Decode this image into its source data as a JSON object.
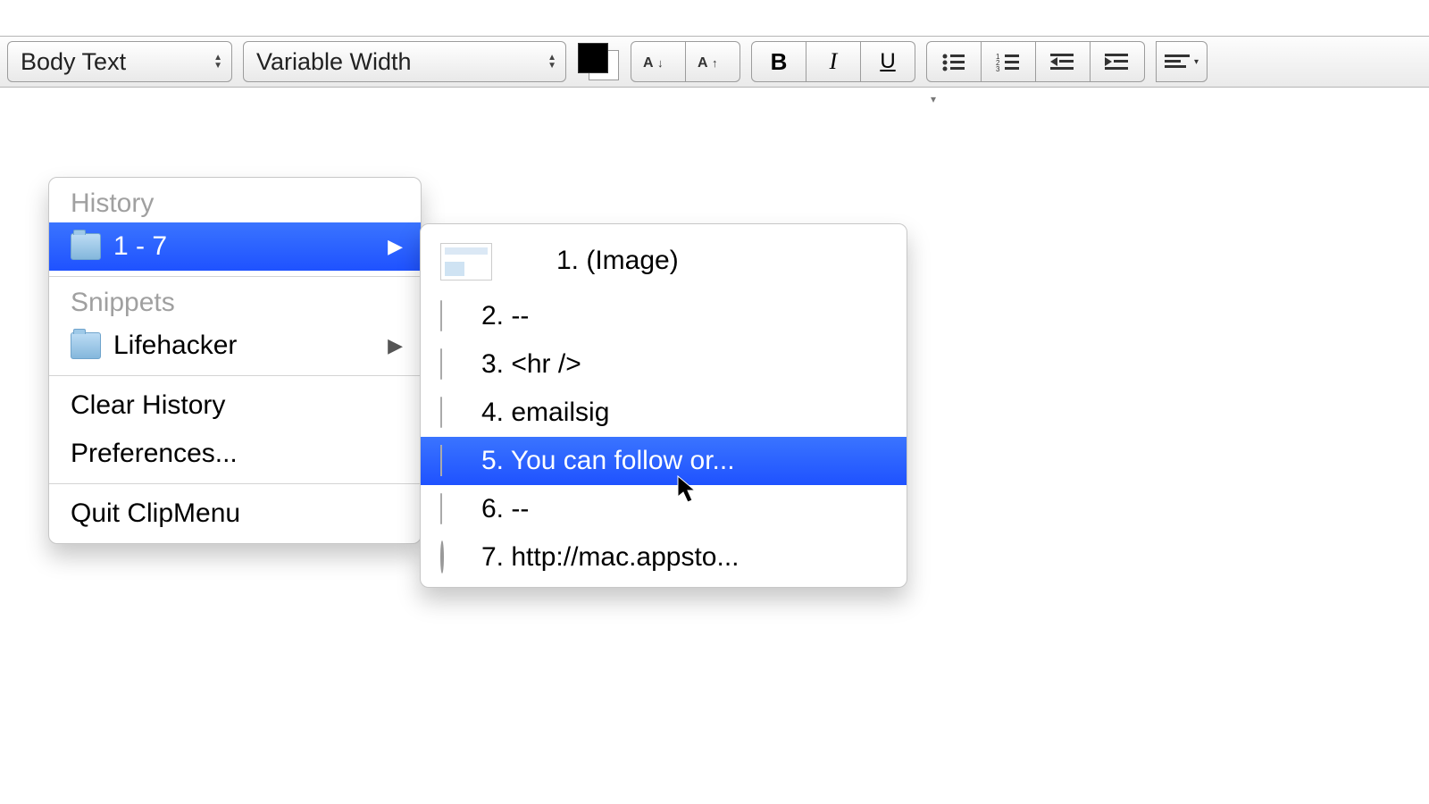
{
  "toolbar": {
    "style_label": "Body Text",
    "font_label": "Variable Width"
  },
  "menu": {
    "history_label": "History",
    "history_range": "1 - 7",
    "snippets_label": "Snippets",
    "snippets_folder": "Lifehacker",
    "clear_label": "Clear History",
    "prefs_label": "Preferences...",
    "quit_label": "Quit ClipMenu"
  },
  "submenu": {
    "items": [
      {
        "n": "1",
        "text": "(Image)",
        "icon": "thumb"
      },
      {
        "n": "2",
        "text": "--",
        "icon": "file"
      },
      {
        "n": "3",
        "text": "<hr />",
        "icon": "file"
      },
      {
        "n": "4",
        "text": "emailsig",
        "icon": "file"
      },
      {
        "n": "5",
        "text": "You can follow or...",
        "icon": "file",
        "selected": true
      },
      {
        "n": "6",
        "text": "--",
        "icon": "file"
      },
      {
        "n": "7",
        "text": "http://mac.appsto...",
        "icon": "globe"
      }
    ]
  }
}
